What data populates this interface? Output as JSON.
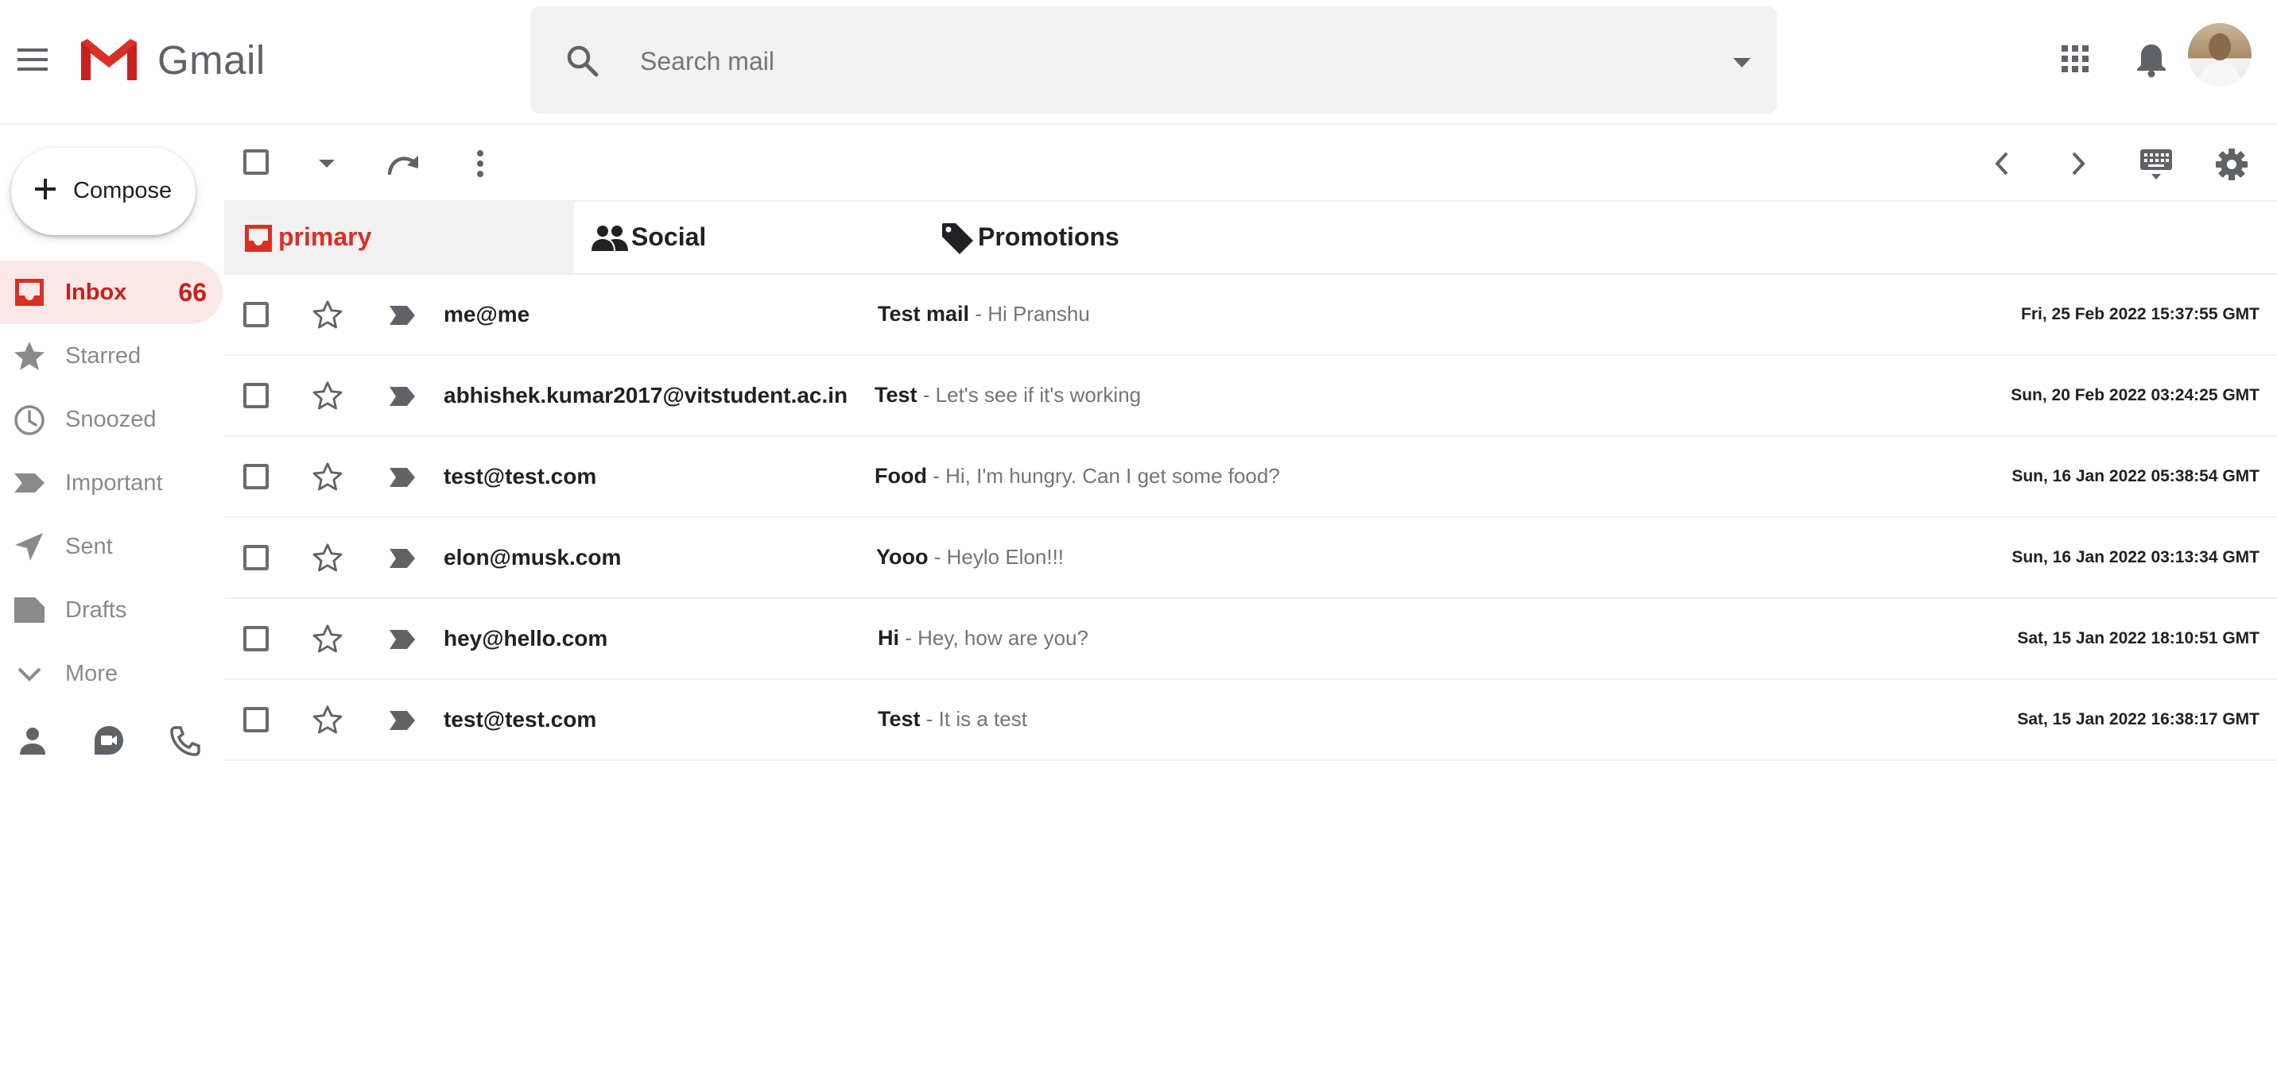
{
  "header": {
    "app_name": "Gmail",
    "search_placeholder": "Search mail"
  },
  "colors": {
    "accent_red": "#d93025",
    "inbox_bg": "#fce8e6",
    "search_bg": "#f1f1f1",
    "icon_gray": "#5f6368"
  },
  "sidebar": {
    "compose_label": "Compose",
    "items": [
      {
        "label": "Inbox",
        "icon": "inbox-icon",
        "count": "66",
        "active": true
      },
      {
        "label": "Starred",
        "icon": "star-icon"
      },
      {
        "label": "Snoozed",
        "icon": "clock-icon"
      },
      {
        "label": "Important",
        "icon": "label-important-icon"
      },
      {
        "label": "Sent",
        "icon": "send-icon"
      },
      {
        "label": "Drafts",
        "icon": "draft-icon"
      },
      {
        "label": "More",
        "icon": "chevron-down-icon"
      }
    ],
    "bottom_icons": [
      "person-icon",
      "video-chat-icon",
      "phone-icon"
    ]
  },
  "toolbar": {
    "icons": [
      "select-all-checkbox",
      "select-dropdown-icon",
      "refresh-icon",
      "more-vert-icon",
      "chevron-left-icon",
      "chevron-right-icon",
      "keyboard-icon",
      "settings-gear-icon"
    ]
  },
  "tabs": [
    {
      "label": "primary",
      "icon": "inbox-icon",
      "active": true
    },
    {
      "label": "Social",
      "icon": "people-icon"
    },
    {
      "label": "Promotions",
      "icon": "tag-icon"
    }
  ],
  "emails": [
    {
      "sender": "me@me",
      "subject": "Test mail",
      "snippet": "Hi Pranshu",
      "date": "Fri, 25 Feb 2022 15:37:55 GMT"
    },
    {
      "sender": "abhishek.kumar2017@vitstudent.ac.in",
      "subject": "Test",
      "snippet": "Let's see if it's working",
      "date": "Sun, 20 Feb 2022 03:24:25 GMT"
    },
    {
      "sender": "test@test.com",
      "subject": "Food",
      "snippet": "Hi, I'm hungry. Can I get some food?",
      "date": "Sun, 16 Jan 2022 05:38:54 GMT"
    },
    {
      "sender": "elon@musk.com",
      "subject": "Yooo",
      "snippet": "Heylo Elon!!!",
      "date": "Sun, 16 Jan 2022 03:13:34 GMT"
    },
    {
      "sender": "hey@hello.com",
      "subject": "Hi",
      "snippet": "Hey, how are you?",
      "date": "Sat, 15 Jan 2022 18:10:51 GMT"
    },
    {
      "sender": "test@test.com",
      "subject": "Test",
      "snippet": "It is a test",
      "date": "Sat, 15 Jan 2022 16:38:17 GMT"
    }
  ],
  "separator": "-"
}
